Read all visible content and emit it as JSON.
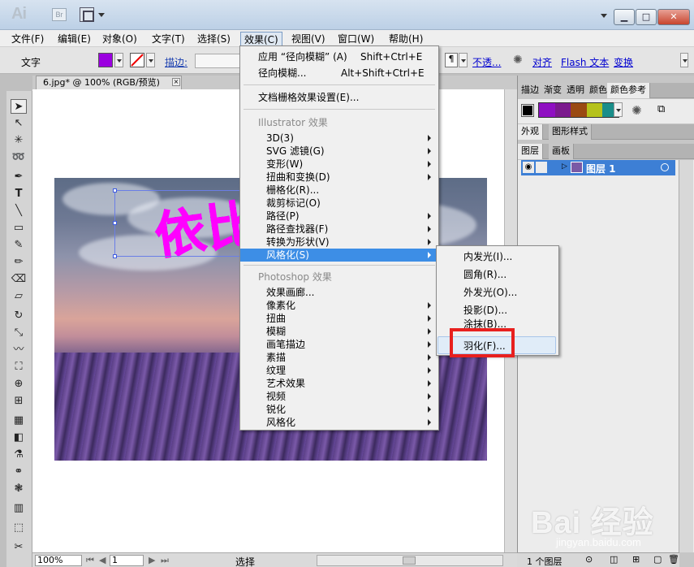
{
  "app": {
    "logo": "Ai",
    "bridge": "Br"
  },
  "window_controls": {
    "minimize": "▁",
    "maximize": "□",
    "close": "✕",
    "workspace_arrow": "▾"
  },
  "menubar": [
    "文件(F)",
    "编辑(E)",
    "对象(O)",
    "文字(T)",
    "选择(S)",
    "效果(C)",
    "视图(V)",
    "窗口(W)",
    "帮助(H)"
  ],
  "control": {
    "mode": "文字",
    "stroke_label": "描边:",
    "opacity_link": "不透...",
    "align_link": "对齐",
    "flash_link": "Flash 文本",
    "transform_link": "变换",
    "fill_color": "#9b00e0"
  },
  "document": {
    "tab_title": "6.jpg* @ 100% (RGB/预览)",
    "close": "×"
  },
  "text_art": "依比",
  "effect_menu": {
    "recent": [
      {
        "label": "应用 “径向模糊” (A)",
        "shortcut": "Shift+Ctrl+E"
      },
      {
        "label": "径向模糊...",
        "shortcut": "Alt+Shift+Ctrl+E"
      }
    ],
    "doc_settings": "文档栅格效果设置(E)...",
    "illustrator_header": "Illustrator 效果",
    "illustrator_items": [
      "3D(3)",
      "SVG 滤镜(G)",
      "变形(W)",
      "扭曲和变换(D)",
      "栅格化(R)...",
      "裁剪标记(O)",
      "路径(P)",
      "路径查找器(F)",
      "转换为形状(V)",
      "风格化(S)"
    ],
    "photoshop_header": "Photoshop 效果",
    "photoshop_items": [
      "效果画廊...",
      "像素化",
      "扭曲",
      "模糊",
      "画笔描边",
      "素描",
      "纹理",
      "艺术效果",
      "视频",
      "锐化",
      "风格化"
    ]
  },
  "sub_menu": [
    "内发光(I)...",
    "圆角(R)...",
    "外发光(O)...",
    "投影(D)...",
    "涂抹(B)...",
    "羽化(F)..."
  ],
  "panels": {
    "top_tabs": [
      "描边",
      "渐变",
      "透明",
      "颜色",
      "颜色参考"
    ],
    "swatches": [
      "#000000",
      "#8f0fc2",
      "#7b1a8d",
      "#9a4a12",
      "#b5c21b",
      "#1a8e8a"
    ],
    "mid_tabs": [
      "外观",
      "图形样式"
    ],
    "layer_tabs": [
      "图层",
      "画板"
    ],
    "layer_name": "图层 1",
    "layer_count": "1 个图层"
  },
  "status": {
    "zoom": "100%",
    "page": "1",
    "mode": "选择"
  },
  "watermark": {
    "brand": "Bai 经验",
    "url": "jingyan.baidu.com"
  }
}
